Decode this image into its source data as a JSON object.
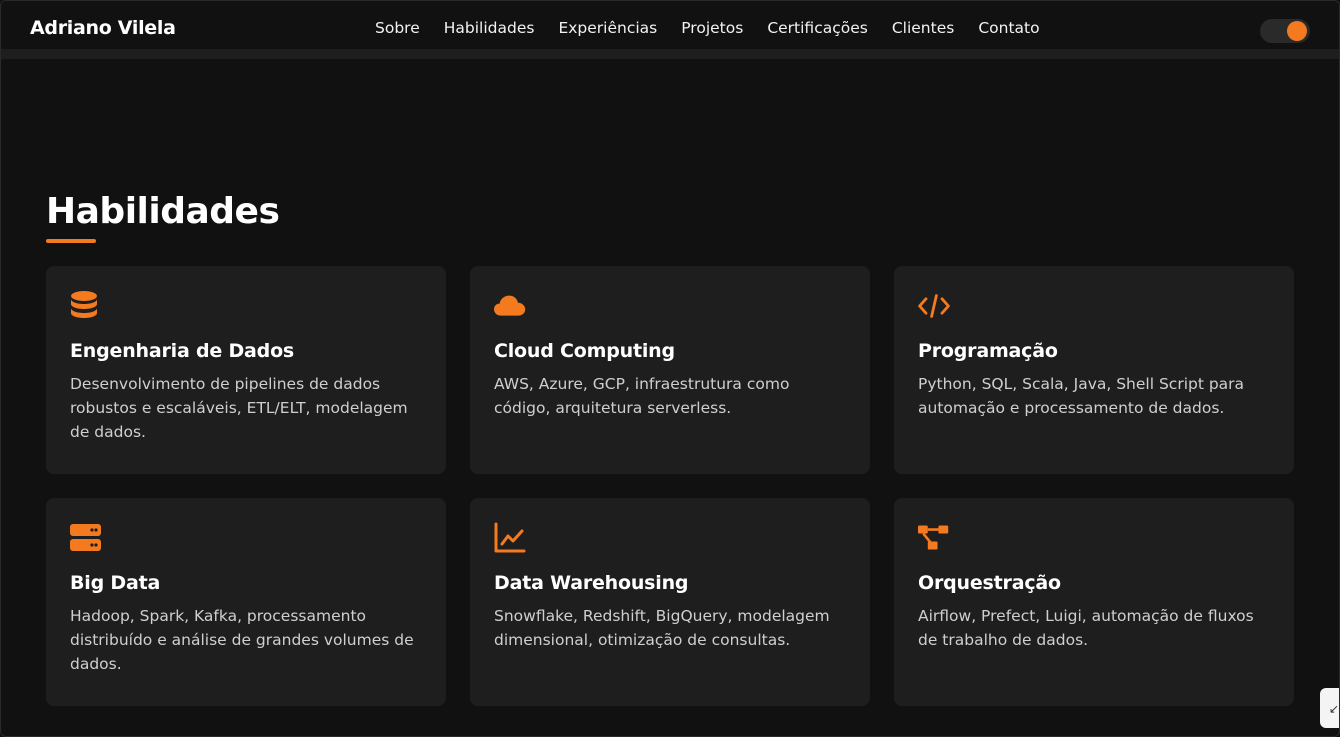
{
  "navbar": {
    "brand": "Adriano Vilela",
    "links": [
      "Sobre",
      "Habilidades",
      "Experiências",
      "Projetos",
      "Certificações",
      "Clientes",
      "Contato"
    ],
    "toggle_icon": "theme-toggle"
  },
  "section": {
    "title": "Habilidades"
  },
  "cards": [
    {
      "icon": "database-icon",
      "title": "Engenharia de Dados",
      "description": "Desenvolvimento de pipelines de dados robustos e escaláveis, ETL/ELT, modelagem de dados."
    },
    {
      "icon": "cloud-icon",
      "title": "Cloud Computing",
      "description": "AWS, Azure, GCP, infraestrutura como código, arquitetura serverless."
    },
    {
      "icon": "code-icon",
      "title": "Programação",
      "description": "Python, SQL, Scala, Java, Shell Script para automação e processamento de dados."
    },
    {
      "icon": "server-icon",
      "title": "Big Data",
      "description": "Hadoop, Spark, Kafka, processamento distribuído e análise de grandes volumes de dados."
    },
    {
      "icon": "chart-line-icon",
      "title": "Data Warehousing",
      "description": "Snowflake, Redshift, BigQuery, modelagem dimensional, otimização de consultas."
    },
    {
      "icon": "workflow-icon",
      "title": "Orquestração",
      "description": "Airflow, Prefect, Luigi, automação de fluxos de trabalho de dados."
    }
  ],
  "colors": {
    "accent": "#f47a20",
    "background": "#121111",
    "card": "#1f1e1e"
  }
}
